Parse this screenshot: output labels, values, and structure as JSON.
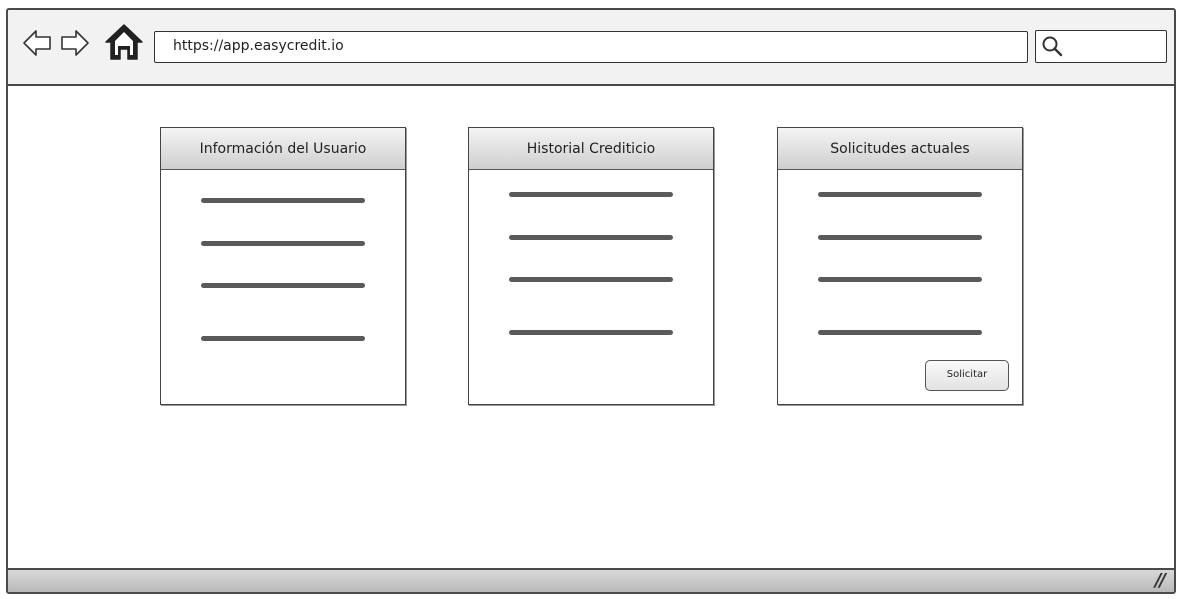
{
  "browser": {
    "url": "https://app.easycredit.io",
    "back_icon": "arrow-left-icon",
    "forward_icon": "arrow-right-icon",
    "home_icon": "home-icon",
    "search_icon": "search-icon"
  },
  "panels": [
    {
      "title": "Información del Usuario",
      "lines": 4
    },
    {
      "title": "Historial Crediticio",
      "lines": 4
    },
    {
      "title": "Solicitudes actuales",
      "lines": 4,
      "button_label": "Solicitar"
    }
  ],
  "statusbar": {
    "resize_glyph": "//"
  }
}
